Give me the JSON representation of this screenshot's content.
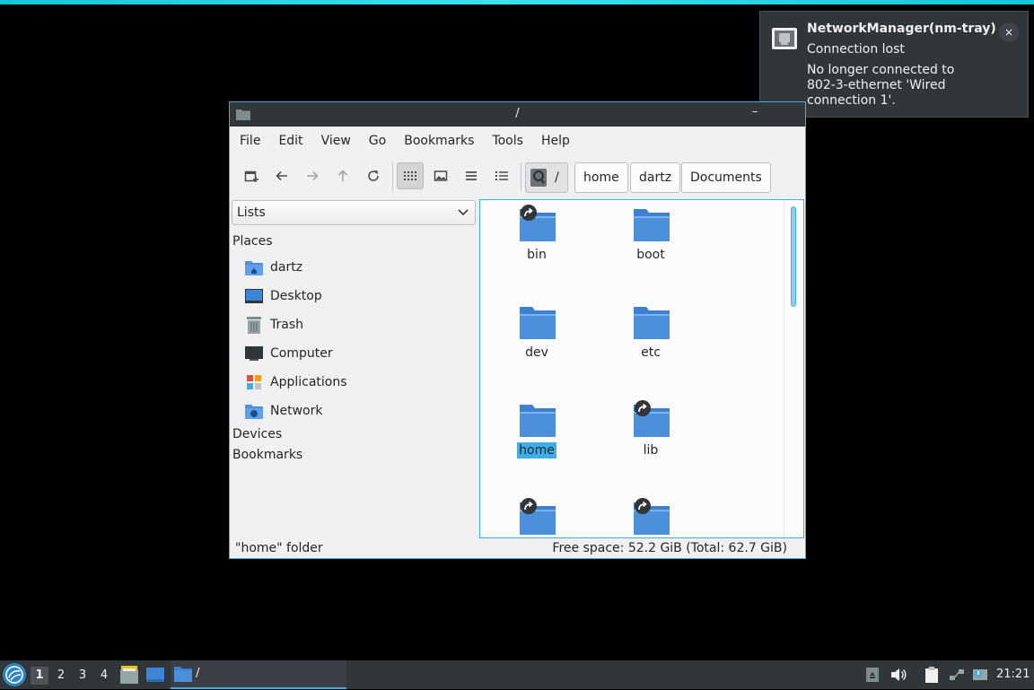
{
  "notification": {
    "title": "NetworkManager(nm-tray)",
    "summary": "Connection lost",
    "body": "No longer connected to 802-3-ethernet 'Wired connection 1'.",
    "close": "×"
  },
  "window": {
    "title": "/",
    "controls": {
      "minimize": "–"
    },
    "menu": [
      "File",
      "Edit",
      "View",
      "Go",
      "Bookmarks",
      "Tools",
      "Help"
    ],
    "toolbar": {
      "icons": [
        "new-tab-icon",
        "back-icon",
        "forward-icon",
        "up-icon",
        "reload-icon",
        "icon-view-icon",
        "thumbnail-view-icon",
        "compact-view-icon",
        "detailed-list-view-icon"
      ],
      "active_view": "icon-view-icon"
    },
    "path_bar": {
      "root": "/",
      "crumbs": [
        "home",
        "dartz",
        "Documents"
      ]
    },
    "side_pane": {
      "mode": "Lists",
      "places_heading": "Places",
      "places": [
        {
          "label": "dartz",
          "icon": "user-home-icon"
        },
        {
          "label": "Desktop",
          "icon": "desktop-icon"
        },
        {
          "label": "Trash",
          "icon": "trash-icon"
        },
        {
          "label": "Computer",
          "icon": "computer-icon"
        },
        {
          "label": "Applications",
          "icon": "applications-icon"
        },
        {
          "label": "Network",
          "icon": "network-icon"
        }
      ],
      "devices_heading": "Devices",
      "bookmarks_heading": "Bookmarks"
    },
    "files": [
      {
        "name": "bin",
        "symlink": true
      },
      {
        "name": "boot",
        "symlink": false
      },
      {
        "name": "dev",
        "symlink": false
      },
      {
        "name": "etc",
        "symlink": false
      },
      {
        "name": "home",
        "symlink": false,
        "selected": true
      },
      {
        "name": "lib",
        "symlink": true
      },
      {
        "name": "",
        "symlink": true
      },
      {
        "name": "",
        "symlink": true
      }
    ],
    "status": {
      "selection": "\"home\" folder",
      "free_space": "Free space: 52.2 GiB (Total: 62.7 GiB)"
    }
  },
  "panel": {
    "desktops": [
      "1",
      "2",
      "3",
      "4"
    ],
    "current_desktop": "1",
    "quicklaunch": [
      "file-manager-icon",
      "show-desktop-icon"
    ],
    "task": {
      "label": "/",
      "icon": "folder-icon"
    },
    "tray": [
      "removable-media-icon",
      "volume-icon",
      "clipboard-icon",
      "network-disconnected-icon",
      "update-notifier-icon"
    ],
    "clock": "21:21"
  },
  "colors": {
    "accent": "#3daee9",
    "folder": "#4c8fdb",
    "dark": "#31363b",
    "top_bar": "#17c5d9"
  }
}
